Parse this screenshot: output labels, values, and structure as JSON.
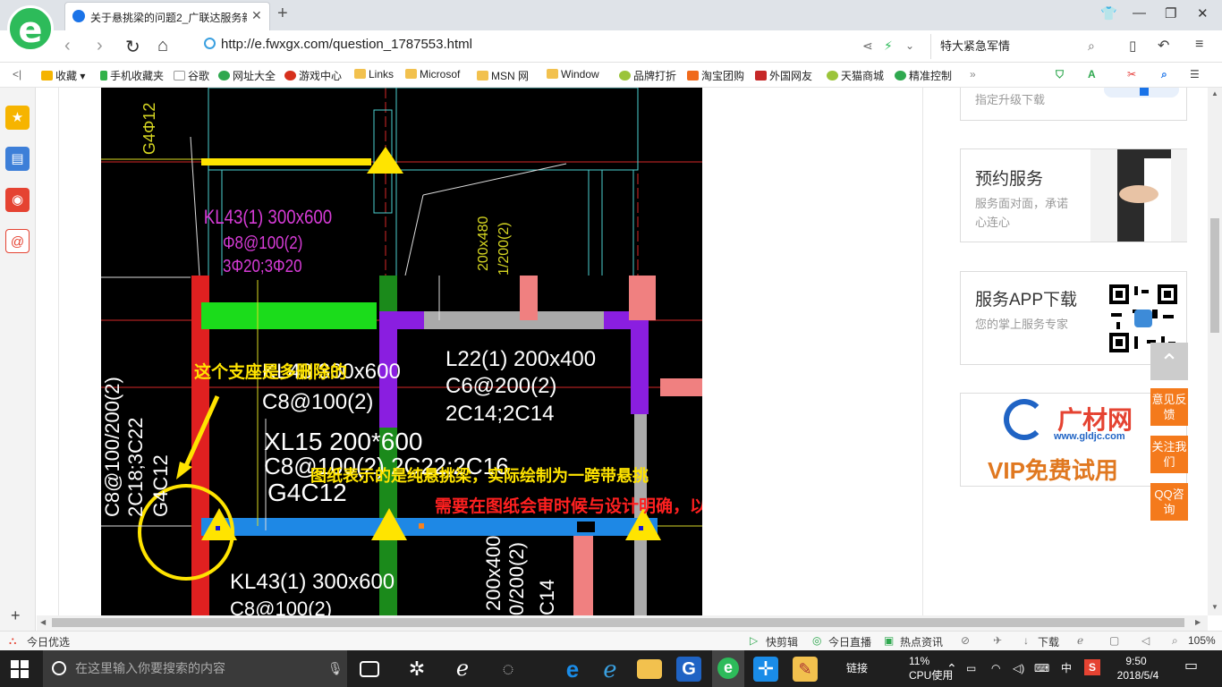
{
  "browser": {
    "tab_title": "关于悬挑梁的问题2_广联达服务新",
    "url": "http://e.fwxgx.com/question_1787553.html",
    "search_text": "特大紧急军情"
  },
  "bookmarks": [
    {
      "label": "收藏",
      "color": "#f5b400"
    },
    {
      "label": "手机收藏夹",
      "color": "#32b24a"
    },
    {
      "label": "谷歌",
      "color": "#999999"
    },
    {
      "label": "网址大全",
      "color": "#2fa84f"
    },
    {
      "label": "游戏中心",
      "color": "#d6301c"
    },
    {
      "label": "Links",
      "color": "#f2c14e"
    },
    {
      "label": "Microsof",
      "color": "#f2c14e"
    },
    {
      "label": "MSN 网",
      "color": "#f2c14e"
    },
    {
      "label": "Window",
      "color": "#f2c14e"
    },
    {
      "label": "品牌打折",
      "color": "#9bc43a"
    },
    {
      "label": "淘宝团购",
      "color": "#f06a1c"
    },
    {
      "label": "外国网友",
      "color": "#c62828"
    },
    {
      "label": "天猫商城",
      "color": "#9bc43a"
    },
    {
      "label": "精准控制",
      "color": "#2fa84f"
    }
  ],
  "cad": {
    "annot_support": "这个支座是多删除的",
    "annot_desc": "图纸表示的是纯悬挑梁，实际绘制为一跨带悬挑",
    "annot_note": "需要在图纸会审时候与设计明确，以利于施工和结算",
    "label_kl43_top": "KL43(1) 300x600",
    "label_kl43_top_2": "Φ8@100(2)",
    "label_kl43_top_3": "3Φ20;3Φ20",
    "label_g4": "G4Φ12",
    "label_l22_1": "L22(1) 200x400",
    "label_l22_2": "C6@200(2)",
    "label_l22_3": "2C14;2C14",
    "label_xl_1": "XL15 200*600",
    "label_xl_2": "C8@100(2)",
    "label_xl_3": "C8@100(2) 2C22;2C16",
    "label_xl_4": "G4C12",
    "label_vert_1": "C8@100/200(2)",
    "label_vert_2": "2C18;3C22",
    "label_vert_3": "G4C12",
    "label_bottom_1": "KL43(1) 300x600",
    "label_bottom_2": "C8@100(2)",
    "label_vert_r": "200x400",
    "label_vert_r2": "0/200(2)",
    "label_vert_r3": "C14",
    "label_vert_top": "200x480",
    "label_vert_top2": "1/200(2)",
    "label_small": "KL43 300x600"
  },
  "sidebar_right": {
    "upgrade": "指定升级下载",
    "service_title": "预约服务",
    "service_sub": "服务面对面，承诺心连心",
    "app_title": "服务APP下载",
    "app_sub": "您的掌上服务专家",
    "ad_brand": "广材网",
    "ad_url": "www.gldjc.com",
    "ad_vip": "VIP免费试用"
  },
  "float_buttons": [
    "意见反馈",
    "关注我们",
    "QQ咨询"
  ],
  "status": {
    "left": "今日优选",
    "items": [
      "快剪辑",
      "今日直播",
      "热点资讯",
      "下载"
    ],
    "zoom": "105%"
  },
  "taskbar": {
    "search_placeholder": "在这里输入你要搜索的内容",
    "link_label": "链接",
    "cpu_percent": "11%",
    "cpu_label": "CPU使用",
    "ime": "中",
    "time": "9:50",
    "date": "2018/5/4"
  }
}
